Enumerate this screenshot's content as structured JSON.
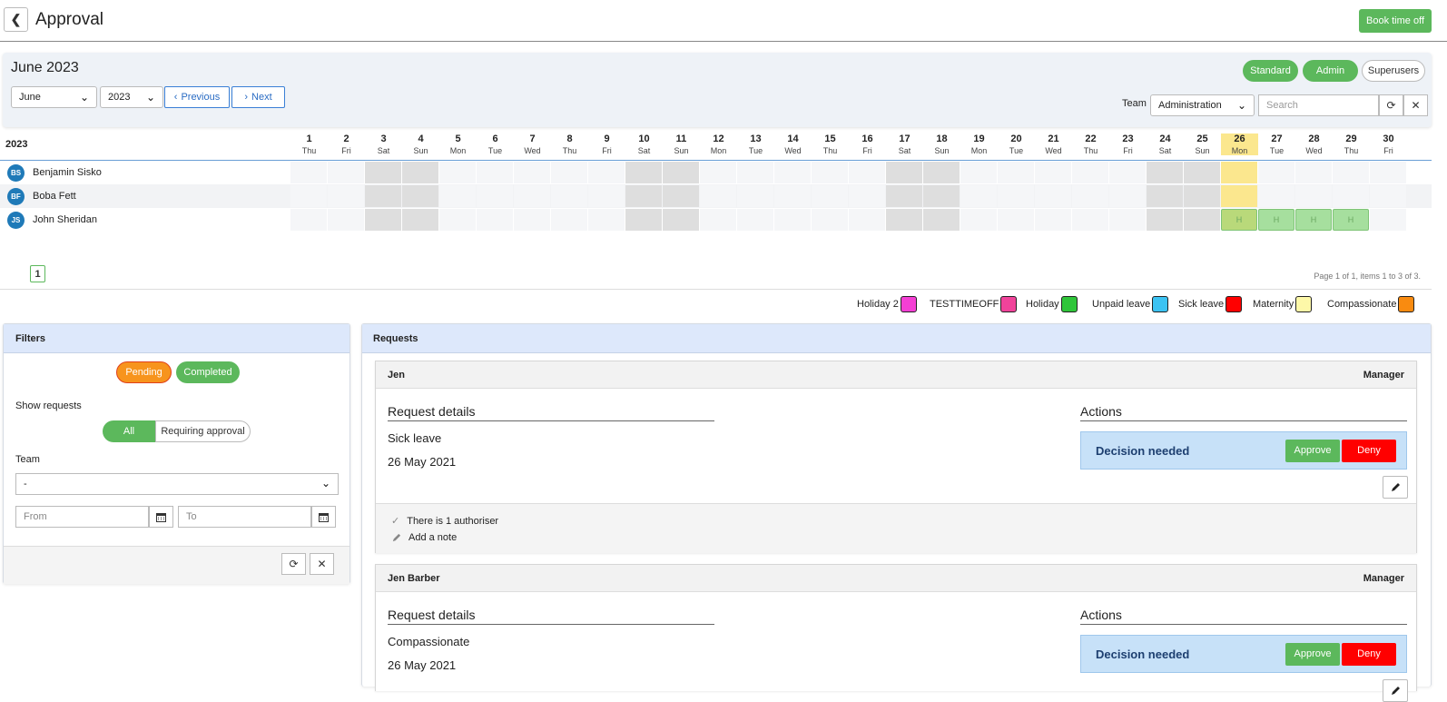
{
  "header": {
    "title": "Approval",
    "book_label": "Book time off"
  },
  "calendar": {
    "title": "June 2023",
    "month_value": "June",
    "year_value": "2023",
    "previous_label": "Previous",
    "next_label": "Next",
    "roles": [
      "Standard",
      "Admin",
      "Superusers"
    ],
    "team_label": "Team",
    "team_value": "Administration",
    "search_placeholder": "Search",
    "grid_year": "2023",
    "days": [
      {
        "n": "1",
        "d": "Thu"
      },
      {
        "n": "2",
        "d": "Fri"
      },
      {
        "n": "3",
        "d": "Sat"
      },
      {
        "n": "4",
        "d": "Sun"
      },
      {
        "n": "5",
        "d": "Mon"
      },
      {
        "n": "6",
        "d": "Tue"
      },
      {
        "n": "7",
        "d": "Wed"
      },
      {
        "n": "8",
        "d": "Thu"
      },
      {
        "n": "9",
        "d": "Fri"
      },
      {
        "n": "10",
        "d": "Sat"
      },
      {
        "n": "11",
        "d": "Sun"
      },
      {
        "n": "12",
        "d": "Mon"
      },
      {
        "n": "13",
        "d": "Tue"
      },
      {
        "n": "14",
        "d": "Wed"
      },
      {
        "n": "15",
        "d": "Thu"
      },
      {
        "n": "16",
        "d": "Fri"
      },
      {
        "n": "17",
        "d": "Sat"
      },
      {
        "n": "18",
        "d": "Sun"
      },
      {
        "n": "19",
        "d": "Mon"
      },
      {
        "n": "20",
        "d": "Tue"
      },
      {
        "n": "21",
        "d": "Wed"
      },
      {
        "n": "22",
        "d": "Thu"
      },
      {
        "n": "23",
        "d": "Fri"
      },
      {
        "n": "24",
        "d": "Sat"
      },
      {
        "n": "25",
        "d": "Sun"
      },
      {
        "n": "26",
        "d": "Mon"
      },
      {
        "n": "27",
        "d": "Tue"
      },
      {
        "n": "28",
        "d": "Wed"
      },
      {
        "n": "29",
        "d": "Thu"
      },
      {
        "n": "30",
        "d": "Fri"
      }
    ],
    "today_day": "26",
    "people": [
      {
        "initials": "BS",
        "name": "Benjamin Sisko",
        "holidays": []
      },
      {
        "initials": "BF",
        "name": "Boba Fett",
        "holidays": []
      },
      {
        "initials": "JS",
        "name": "John Sheridan",
        "holidays": [
          "26",
          "27",
          "28",
          "29"
        ]
      }
    ],
    "holiday_marker": "H",
    "page_number": "1",
    "page_info": "Page 1 of 1, items 1 to 3 of 3."
  },
  "legend": [
    {
      "label": "Holiday 2",
      "color": "#f43fd4"
    },
    {
      "label": "TESTTIMEOFF",
      "color": "#f0439a"
    },
    {
      "label": "Holiday",
      "color": "#2fc53a"
    },
    {
      "label": "Unpaid leave",
      "color": "#3cc3f3"
    },
    {
      "label": "Sick leave",
      "color": "#ff0000"
    },
    {
      "label": "Maternity",
      "color": "#fdf8a8"
    },
    {
      "label": "Compassionate",
      "color": "#f98b10"
    }
  ],
  "filters": {
    "title": "Filters",
    "pending_label": "Pending",
    "completed_label": "Completed",
    "show_requests_label": "Show requests",
    "all_label": "All",
    "requiring_label": "Requiring approval",
    "team_label": "Team",
    "team_value": "-",
    "from_placeholder": "From",
    "to_placeholder": "To"
  },
  "requests": {
    "title": "Requests",
    "items": [
      {
        "name": "Jen",
        "role": "Manager",
        "details_title": "Request details",
        "type": "Sick leave",
        "date": "26 May 2021",
        "actions_title": "Actions",
        "decision_text": "Decision needed",
        "approve_label": "Approve",
        "deny_label": "Deny",
        "authorisers": "There is 1 authoriser",
        "add_note": "Add a note"
      },
      {
        "name": "Jen Barber",
        "role": "Manager",
        "details_title": "Request details",
        "type": "Compassionate",
        "date": "26 May 2021",
        "actions_title": "Actions",
        "decision_text": "Decision needed",
        "approve_label": "Approve",
        "deny_label": "Deny"
      }
    ]
  }
}
